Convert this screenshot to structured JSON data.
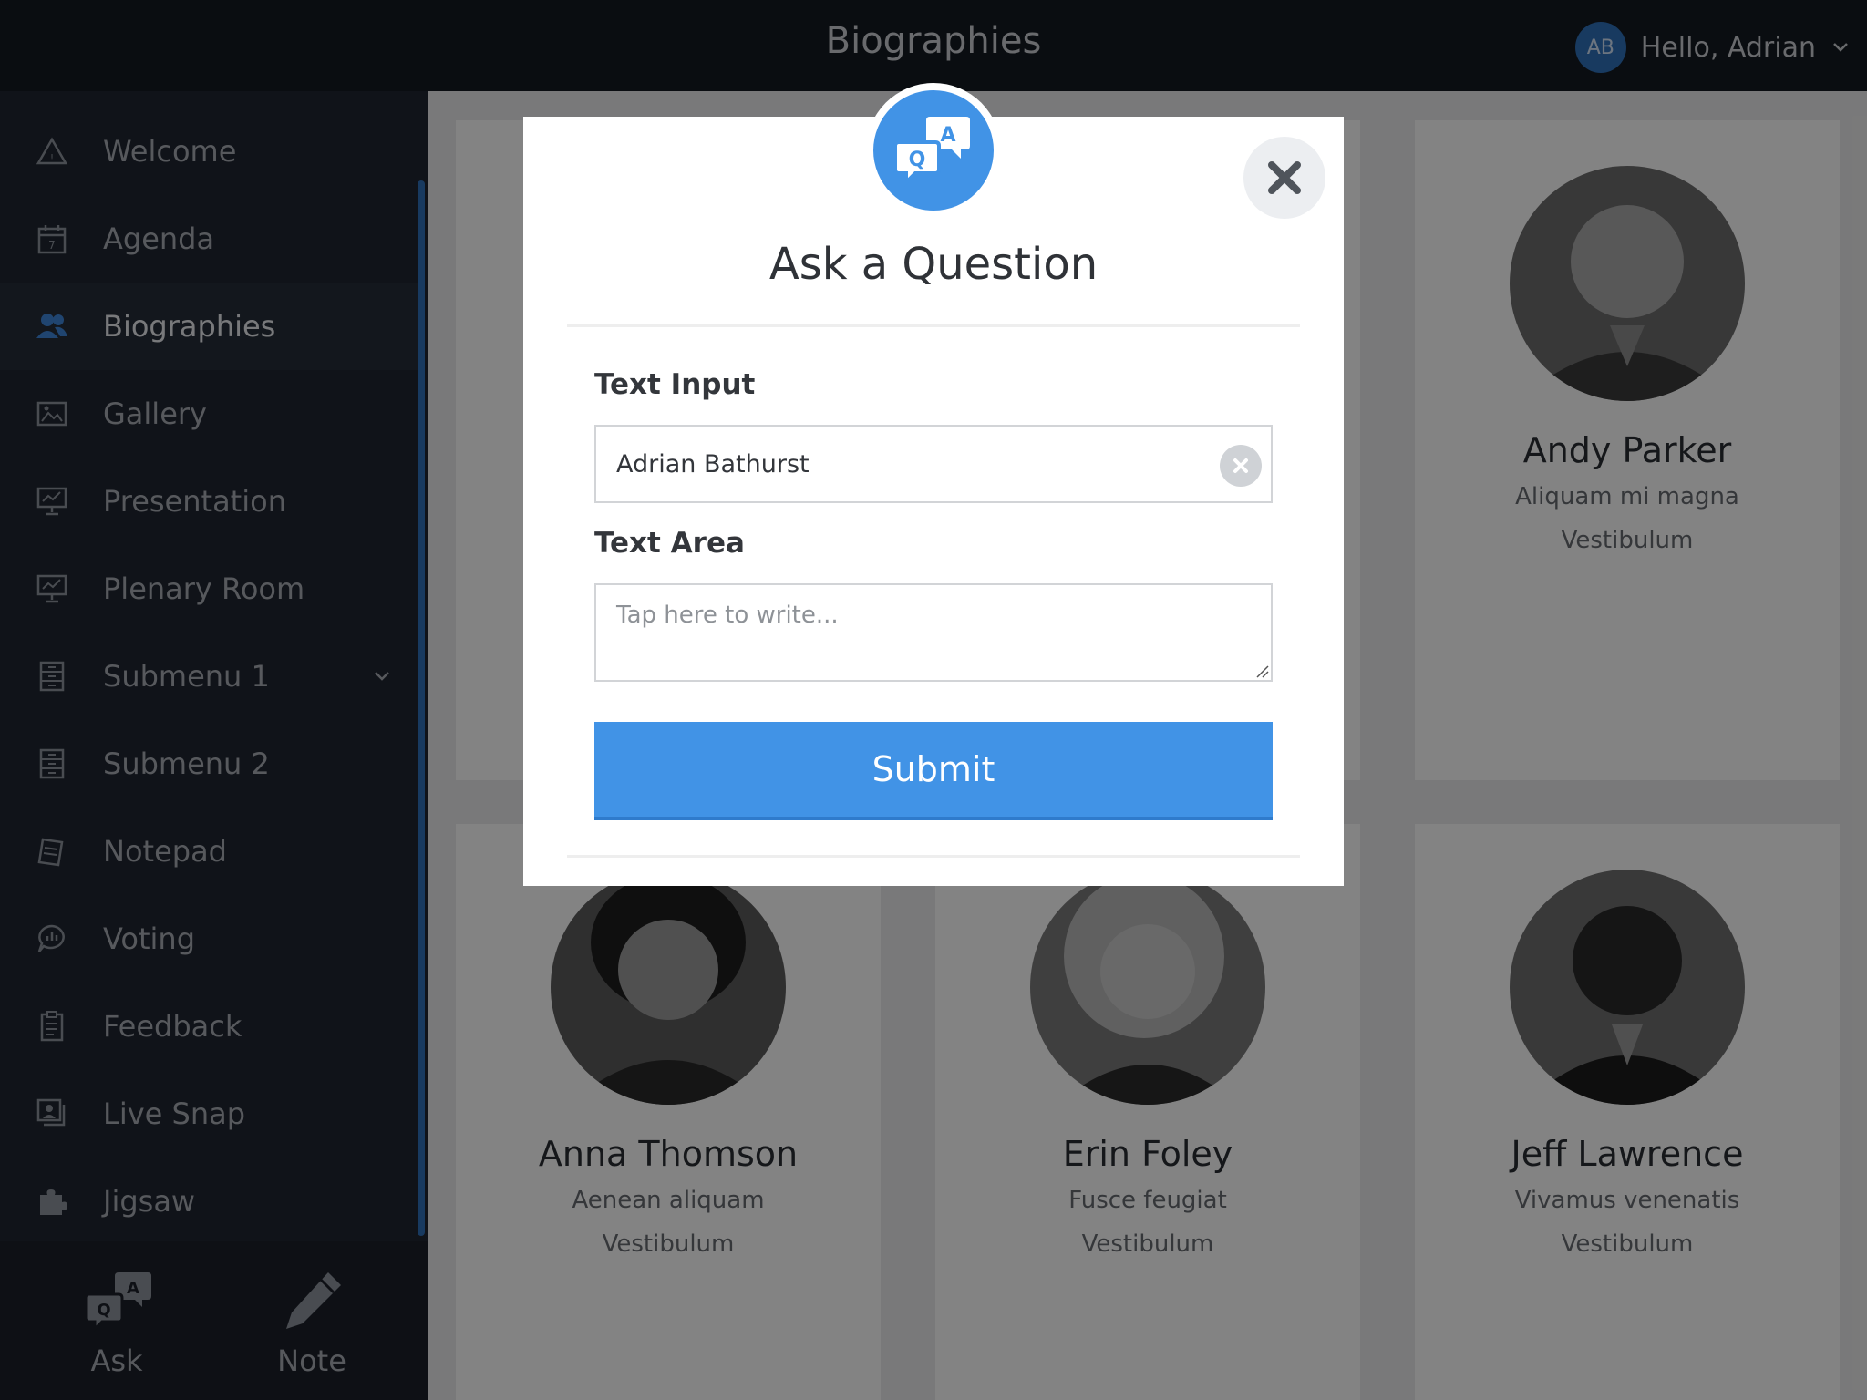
{
  "header": {
    "title": "Biographies",
    "avatar_initials": "AB",
    "greeting": "Hello, Adrian"
  },
  "sidebar": {
    "items": [
      {
        "label": "Welcome",
        "icon": "warning-triangle-icon"
      },
      {
        "label": "Agenda",
        "icon": "calendar-icon"
      },
      {
        "label": "Biographies",
        "icon": "users-icon",
        "active": true
      },
      {
        "label": "Gallery",
        "icon": "image-icon"
      },
      {
        "label": "Presentation",
        "icon": "presentation-icon"
      },
      {
        "label": "Plenary Room",
        "icon": "presentation-icon"
      },
      {
        "label": "Submenu 1",
        "icon": "cabinet-icon",
        "has_submenu": true
      },
      {
        "label": "Submenu 2",
        "icon": "cabinet-icon"
      },
      {
        "label": "Notepad",
        "icon": "notepad-icon"
      },
      {
        "label": "Voting",
        "icon": "voting-bubble-icon"
      },
      {
        "label": "Feedback",
        "icon": "clipboard-icon"
      },
      {
        "label": "Live Snap",
        "icon": "photo-stack-icon"
      },
      {
        "label": "Jigsaw",
        "icon": "puzzle-icon"
      }
    ],
    "bottom": {
      "ask_label": "Ask",
      "note_label": "Note"
    }
  },
  "cards": [
    {
      "name": "Andy Parker",
      "line1": "Aliquam mi magna",
      "line2": "Vestibulum"
    },
    {
      "name": "Anna Thomson",
      "line1": "Aenean aliquam",
      "line2": "Vestibulum"
    },
    {
      "name": "Erin Foley",
      "line1": "Fusce feugiat",
      "line2": "Vestibulum"
    },
    {
      "name": "Jeff Lawrence",
      "line1": "Vivamus venenatis",
      "line2": "Vestibulum"
    }
  ],
  "modal": {
    "title": "Ask a Question",
    "badge_q": "Q",
    "badge_a": "A",
    "text_input_label": "Text Input",
    "text_input_value": "Adrian Bathurst",
    "text_area_label": "Text Area",
    "text_area_placeholder": "Tap here to write...",
    "submit_label": "Submit"
  },
  "colors": {
    "accent": "#4193e6",
    "header_bg": "#151a22",
    "sidebar_bg": "#1f2530"
  }
}
